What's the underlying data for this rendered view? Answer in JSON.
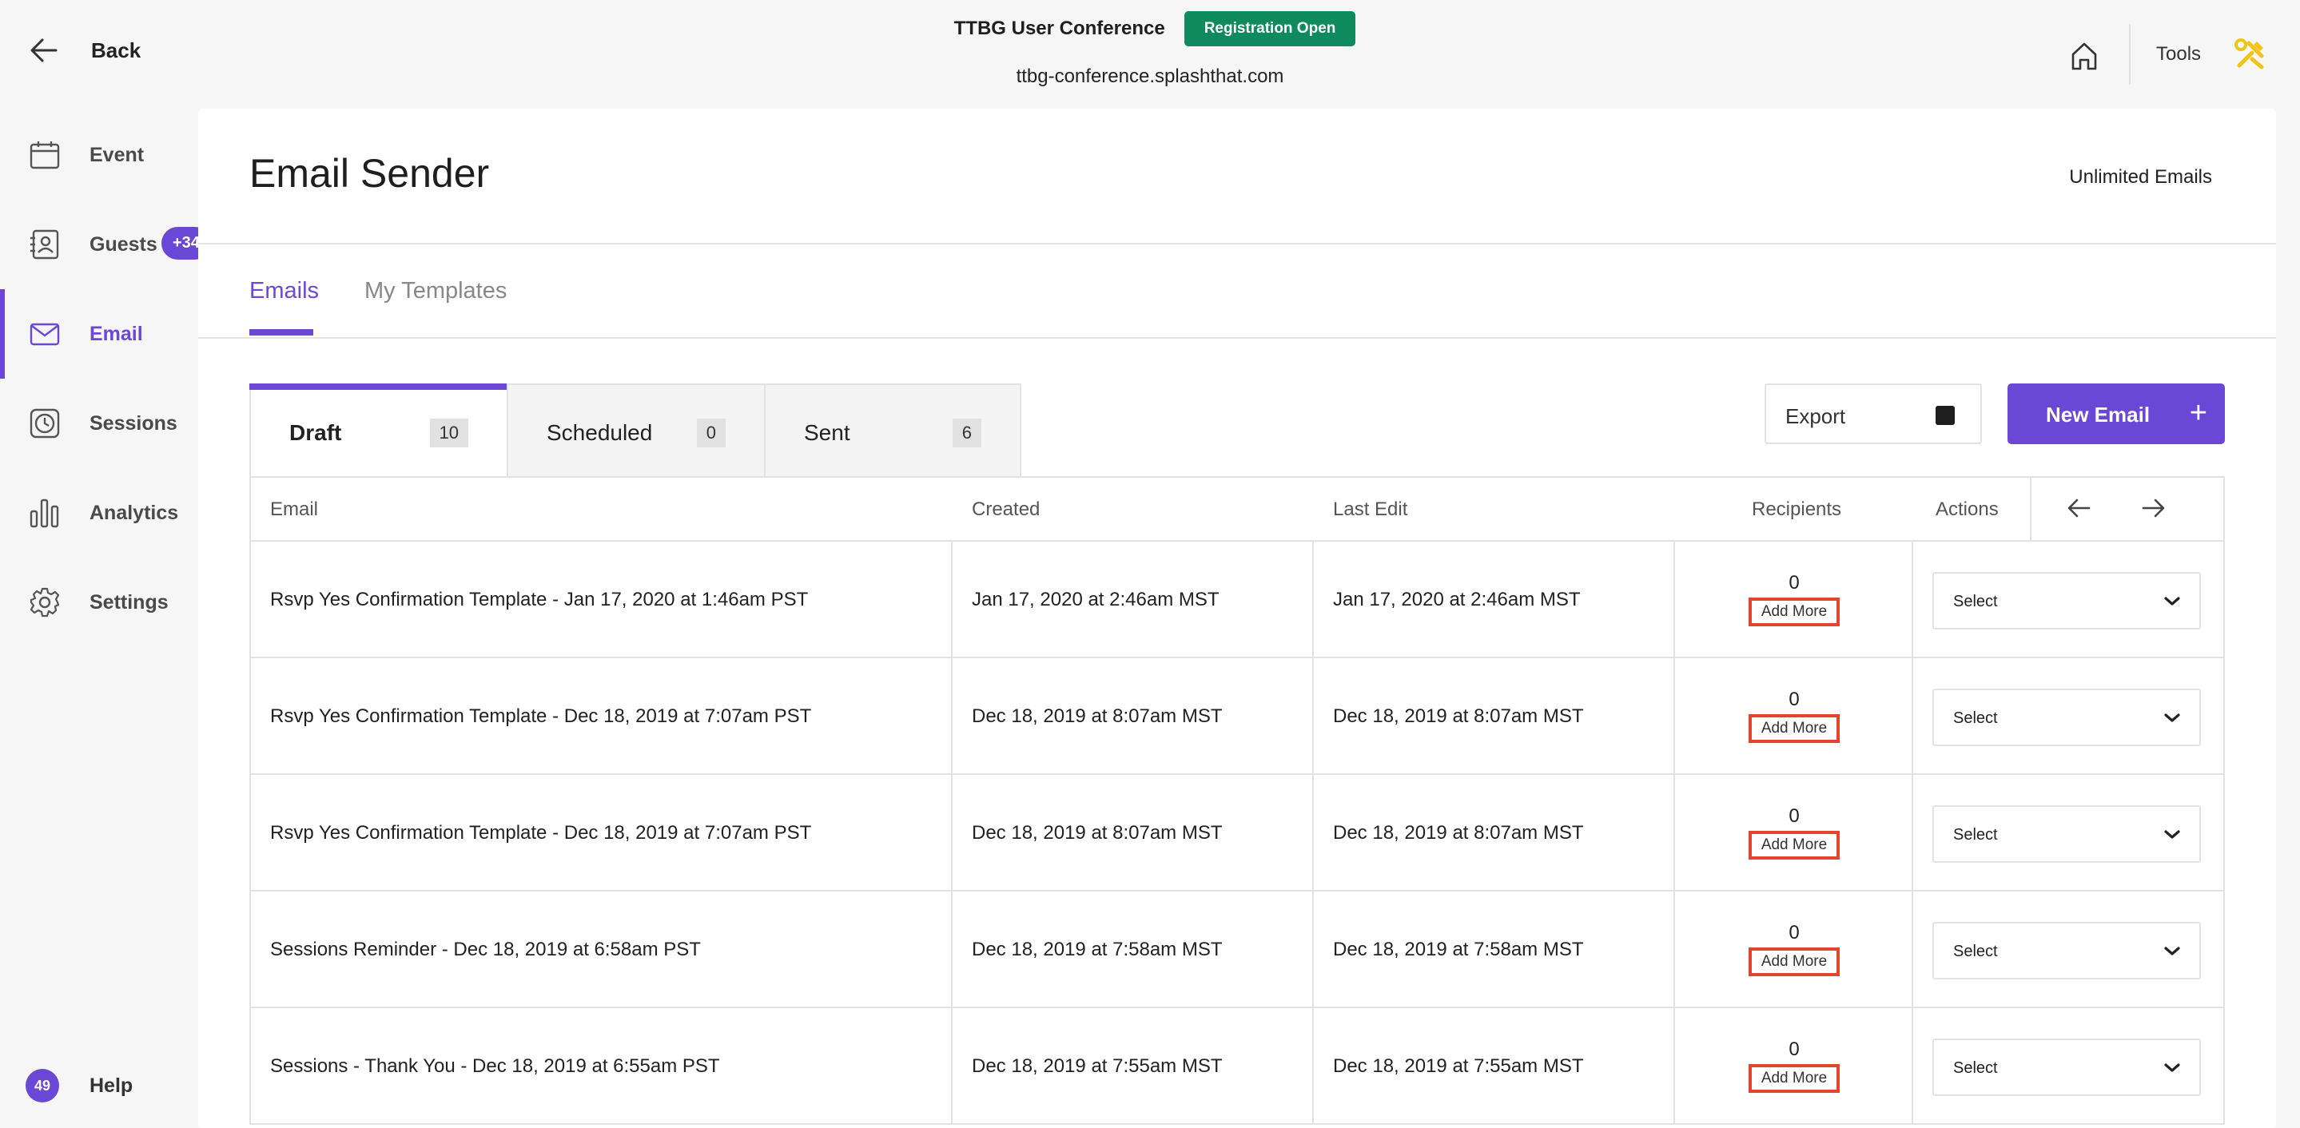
{
  "topbar": {
    "back_label": "Back",
    "event_title": "TTBG User Conference",
    "registration_badge": "Registration Open",
    "event_url": "ttbg-conference.splashthat.com",
    "tools_label": "Tools"
  },
  "sidebar": {
    "items": [
      {
        "label": "Event",
        "icon": "calendar-icon"
      },
      {
        "label": "Guests",
        "icon": "contact-card-icon"
      },
      {
        "label": "Email",
        "icon": "mail-icon"
      },
      {
        "label": "Sessions",
        "icon": "clock-icon"
      },
      {
        "label": "Analytics",
        "icon": "bar-chart-icon"
      },
      {
        "label": "Settings",
        "icon": "gear-icon"
      }
    ],
    "active": "Email",
    "guests_badge": "+34",
    "help_badge": "49",
    "help_label": "Help"
  },
  "main": {
    "title": "Email Sender",
    "quota": "Unlimited Emails",
    "tabs": [
      {
        "label": "Emails",
        "active": true
      },
      {
        "label": "My Templates",
        "active": false
      }
    ],
    "subtabs": [
      {
        "label": "Draft",
        "count": "10",
        "active": true
      },
      {
        "label": "Scheduled",
        "count": "0",
        "active": false
      },
      {
        "label": "Sent",
        "count": "6",
        "active": false
      }
    ],
    "export_label": "Export",
    "new_email_label": "New Email",
    "new_email_plus": "+"
  },
  "table": {
    "columns": [
      "Email",
      "Created",
      "Last Edit",
      "Recipients",
      "Actions"
    ],
    "rows": [
      {
        "email": "Rsvp Yes Confirmation Template - Jan 17, 2020 at 1:46am PST",
        "created": "Jan 17, 2020 at 2:46am MST",
        "last_edit": "Jan 17, 2020 at 2:46am MST",
        "recipients": "0",
        "add_more": "Add More",
        "action": "Select"
      },
      {
        "email": "Rsvp Yes Confirmation Template - Dec 18, 2019 at 7:07am PST",
        "created": "Dec 18, 2019 at 8:07am MST",
        "last_edit": "Dec 18, 2019 at 8:07am MST",
        "recipients": "0",
        "add_more": "Add More",
        "action": "Select"
      },
      {
        "email": "Rsvp Yes Confirmation Template - Dec 18, 2019 at 7:07am PST",
        "created": "Dec 18, 2019 at 8:07am MST",
        "last_edit": "Dec 18, 2019 at 8:07am MST",
        "recipients": "0",
        "add_more": "Add More",
        "action": "Select"
      },
      {
        "email": "Sessions Reminder - Dec 18, 2019 at 6:58am PST",
        "created": "Dec 18, 2019 at 7:58am MST",
        "last_edit": "Dec 18, 2019 at 7:58am MST",
        "recipients": "0",
        "add_more": "Add More",
        "action": "Select"
      },
      {
        "email": "Sessions - Thank You - Dec 18, 2019 at 6:55am PST",
        "created": "Dec 18, 2019 at 7:55am MST",
        "last_edit": "Dec 18, 2019 at 7:55am MST",
        "recipients": "0",
        "add_more": "Add More",
        "action": "Select"
      }
    ]
  },
  "colors": {
    "accent": "#6b47d6",
    "badge_green": "#0f8a5f",
    "highlight_red": "#e0462e"
  }
}
